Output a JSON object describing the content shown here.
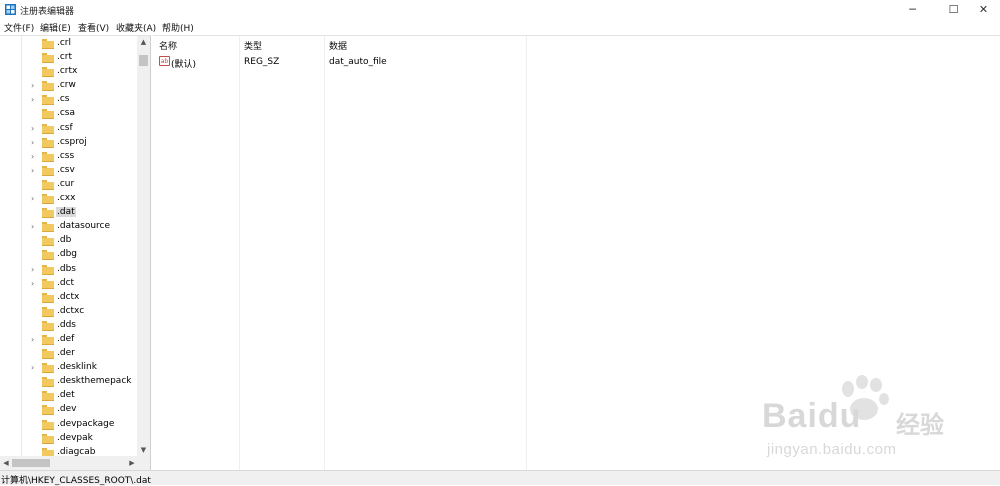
{
  "window": {
    "title": "注册表编辑器",
    "icon": "registry-editor-icon",
    "controls": [
      "─",
      "☐",
      "✕"
    ]
  },
  "menu": [
    "文件(F)",
    "编辑(E)",
    "查看(V)",
    "收藏夹(A)",
    "帮助(H)"
  ],
  "tree": {
    "items": [
      {
        "label": ".crl",
        "expandable": false
      },
      {
        "label": ".crt",
        "expandable": false
      },
      {
        "label": ".crtx",
        "expandable": false
      },
      {
        "label": ".crw",
        "expandable": true
      },
      {
        "label": ".cs",
        "expandable": true
      },
      {
        "label": ".csa",
        "expandable": false
      },
      {
        "label": ".csf",
        "expandable": true
      },
      {
        "label": ".csproj",
        "expandable": true
      },
      {
        "label": ".css",
        "expandable": true
      },
      {
        "label": ".csv",
        "expandable": true
      },
      {
        "label": ".cur",
        "expandable": false
      },
      {
        "label": ".cxx",
        "expandable": true
      },
      {
        "label": ".dat",
        "expandable": false,
        "selected": true
      },
      {
        "label": ".datasource",
        "expandable": true
      },
      {
        "label": ".db",
        "expandable": false
      },
      {
        "label": ".dbg",
        "expandable": false
      },
      {
        "label": ".dbs",
        "expandable": true
      },
      {
        "label": ".dct",
        "expandable": true
      },
      {
        "label": ".dctx",
        "expandable": false
      },
      {
        "label": ".dctxc",
        "expandable": false
      },
      {
        "label": ".dds",
        "expandable": false
      },
      {
        "label": ".def",
        "expandable": true
      },
      {
        "label": ".der",
        "expandable": false
      },
      {
        "label": ".desklink",
        "expandable": true
      },
      {
        "label": ".deskthemepack",
        "expandable": false
      },
      {
        "label": ".det",
        "expandable": false
      },
      {
        "label": ".dev",
        "expandable": false
      },
      {
        "label": ".devpackage",
        "expandable": false
      },
      {
        "label": ".devpak",
        "expandable": false
      },
      {
        "label": ".diagcab",
        "expandable": false
      }
    ]
  },
  "list": {
    "columns": [
      "名称",
      "类型",
      "数据"
    ],
    "rows": [
      {
        "icon": "string-value-icon",
        "icon_text": "ab",
        "name": "(默认)",
        "type": "REG_SZ",
        "data": "dat_auto_file"
      }
    ]
  },
  "status_bar": {
    "path": "计算机\\HKEY_CLASSES_ROOT\\.dat"
  },
  "watermark": {
    "brand": "Baidu",
    "cn": "经验",
    "url": "jingyan.baidu.com"
  },
  "colors": {
    "folder": "#f2c95e",
    "selection": "#d9d9d9",
    "string_icon": "#c0504d"
  }
}
